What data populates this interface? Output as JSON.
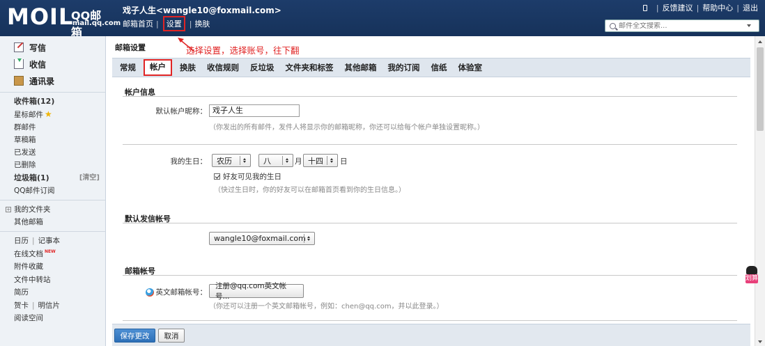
{
  "header": {
    "logo_main": "MOIL",
    "logo_name": "QQ邮箱",
    "logo_url": "mail.qq.com",
    "user": "戏子人生<wangle10@foxmail.com>",
    "links": [
      "邮箱首页",
      "设置",
      "换肤"
    ],
    "top_links": [
      "反馈建议",
      "帮助中心",
      "退出"
    ],
    "search_placeholder": "邮件全文搜索..."
  },
  "sidebar": {
    "main": [
      "写信",
      "收信",
      "通讯录"
    ],
    "folders": {
      "inbox": "收件箱(12)",
      "starred": "星标邮件",
      "group": "群邮件",
      "drafts": "草稿箱",
      "sent": "已发送",
      "deleted": "已删除",
      "spam": "垃圾箱(1)",
      "spam_clear": "[清空]",
      "subscribe": "QQ邮件订阅"
    },
    "myfolders": {
      "my": "我的文件夹",
      "other": "其他邮箱"
    },
    "tools": {
      "calendar": "日历",
      "notes": "记事本",
      "docs": "在线文档",
      "new_badge": "NEW",
      "attachments": "附件收藏",
      "transfer": "文件中转站",
      "resume": "简历",
      "cards": "贺卡",
      "postcards": "明信片",
      "reading": "阅读空间"
    }
  },
  "main": {
    "title": "邮箱设置",
    "annotation": "选择设置，选择账号，往下翻",
    "tabs": [
      "常规",
      "帐户",
      "换肤",
      "收信规则",
      "反垃圾",
      "文件夹和标签",
      "其他邮箱",
      "我的订阅",
      "信纸",
      "体验室"
    ],
    "account_info": {
      "title": "帐户信息",
      "nickname_label": "默认帐户昵称：",
      "nickname_value": "戏子人生",
      "nickname_hint": "（你发出的所有邮件，发件人将显示你的邮箱昵称，你还可以给每个帐户单独设置昵称。）",
      "birthday_label": "我的生日：",
      "calendar_type": "农历",
      "month": "八",
      "month_suffix": "月",
      "day": "十四",
      "day_suffix": "日",
      "show_birthday": "好友可见我的生日",
      "birthday_hint": "（快过生日时，你的好友可以在邮箱首页看到你的生日信息。）"
    },
    "default_sender": {
      "title": "默认发信帐号",
      "value": "wangle10@foxmail.com"
    },
    "mailbox_account": {
      "title": "邮箱帐号",
      "english_label": "英文邮箱帐号：",
      "register_button": "注册@qq.com英文帐号...",
      "hint": "（你还可以注册一个英文邮箱帐号，例如：chen@qq.com，并以此登录。）"
    },
    "buttons": {
      "save": "保存更改",
      "cancel": "取消"
    }
  },
  "widget": {
    "text": "划算"
  }
}
